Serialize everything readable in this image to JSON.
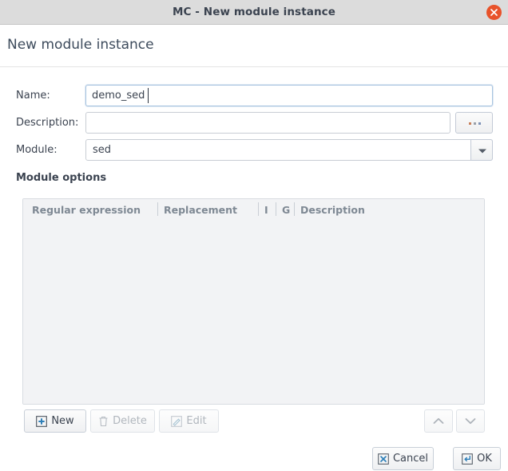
{
  "window": {
    "title": "MC - New module instance",
    "close_icon": "close-circle-icon"
  },
  "header": {
    "title": "New module instance"
  },
  "form": {
    "name": {
      "label": "Name:",
      "value": "demo_sed",
      "placeholder": ""
    },
    "description": {
      "label": "Description:",
      "value": "",
      "placeholder": "",
      "browse_label": "...",
      "browse_icon": "ellipsis-icon"
    },
    "module": {
      "label": "Module:",
      "value": "sed",
      "dropdown_icon": "chevron-down-icon"
    }
  },
  "module_options": {
    "section_title": "Module options",
    "columns": [
      "Regular expression",
      "Replacement",
      "I",
      "G",
      "Description"
    ],
    "rows": []
  },
  "actions": {
    "new": {
      "label": "New",
      "icon": "plus-box-icon",
      "enabled": true
    },
    "delete": {
      "label": "Delete",
      "icon": "trash-icon",
      "enabled": false
    },
    "edit": {
      "label": "Edit",
      "icon": "pencil-icon",
      "enabled": false
    },
    "move_up": {
      "label": "",
      "icon": "chevron-up-icon",
      "enabled": false
    },
    "move_down": {
      "label": "",
      "icon": "chevron-down-icon",
      "enabled": false
    }
  },
  "footer": {
    "cancel": {
      "label": "Cancel",
      "icon": "cancel-x-box-icon"
    },
    "ok": {
      "label": "OK",
      "icon": "enter-return-icon"
    }
  },
  "colors": {
    "titlebar_bg": "#dcdcdc",
    "close_button": "#e8522a",
    "accent_blue": "#2e7fb8",
    "header_text": "#3d4b5c",
    "table_bg": "#f2f3f5",
    "column_header_text": "#7f8994"
  }
}
